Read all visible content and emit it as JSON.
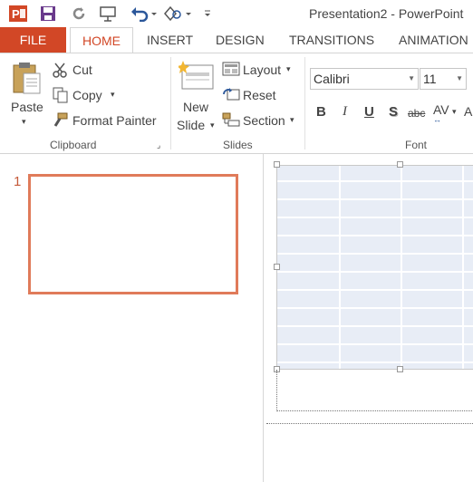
{
  "window": {
    "title": "Presentation2 - PowerPoint"
  },
  "qat": {
    "icons": [
      "powerpoint-logo-icon",
      "save-icon",
      "repeat-icon",
      "presentation-icon",
      "undo-icon",
      "shapes-icon",
      "customize-qat-icon"
    ]
  },
  "tabs": {
    "file": "FILE",
    "home": "HOME",
    "insert": "INSERT",
    "design": "DESIGN",
    "transitions": "TRANSITIONS",
    "animations": "ANIMATION"
  },
  "clipboard": {
    "paste": "Paste",
    "cut": "Cut",
    "copy": "Copy",
    "format_painter": "Format Painter",
    "label": "Clipboard"
  },
  "slides_group": {
    "new_slide_1": "New",
    "new_slide_2": "Slide",
    "layout": "Layout",
    "reset": "Reset",
    "section": "Section",
    "label": "Slides"
  },
  "font_group": {
    "font_name": "Calibri",
    "font_size": "11",
    "bold": "B",
    "italic": "I",
    "underline": "U",
    "shadow": "S",
    "strike": "abc",
    "spacing": "AV",
    "label": "Font"
  },
  "thumbnails": {
    "slide_number": "1"
  },
  "colors": {
    "accent": "#d24726",
    "thumb_border": "#e07b5a",
    "table_fill": "#e8edf6"
  }
}
